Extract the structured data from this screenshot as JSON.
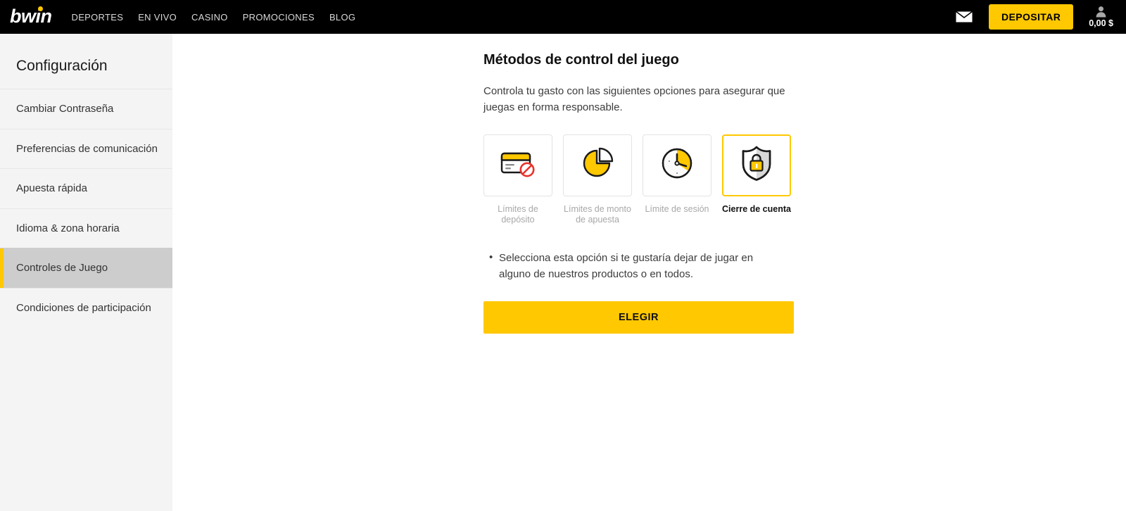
{
  "header": {
    "logo_text": "bwin",
    "logo_dot_color": "#ffc800",
    "nav": [
      {
        "label": "DEPORTES",
        "name": "nav-deportes"
      },
      {
        "label": "EN VIVO",
        "name": "nav-en-vivo"
      },
      {
        "label": "CASINO",
        "name": "nav-casino"
      },
      {
        "label": "PROMOCIONES",
        "name": "nav-promociones"
      },
      {
        "label": "BLOG",
        "name": "nav-blog"
      }
    ],
    "mail_icon": "envelope-icon",
    "deposit_label": "DEPOSITAR",
    "account_icon": "person-icon",
    "balance": "0,00 $",
    "accent_color": "#ffc800",
    "background": "#000000"
  },
  "sidebar": {
    "title": "Configuración",
    "background": "#f4f4f4",
    "active_background": "#cdcdcd",
    "active_marker_color": "#ffc800",
    "items": [
      {
        "label": "Cambiar Contraseña",
        "active": false
      },
      {
        "label": "Preferencias de comunicación",
        "active": false
      },
      {
        "label": "Apuesta rápida",
        "active": false
      },
      {
        "label": "Idioma & zona horaria",
        "active": false
      },
      {
        "label": "Controles de Juego",
        "active": true
      },
      {
        "label": "Condiciones de participación",
        "active": false
      }
    ]
  },
  "main": {
    "title": "Métodos de control del juego",
    "intro": "Controla tu gasto con las siguientes opciones para asegurar que juegas en forma responsable.",
    "options": [
      {
        "label": "Límites de depósito",
        "icon": "credit-card-blocked-icon",
        "selected": false
      },
      {
        "label": "Límites de monto de apuesta",
        "icon": "pie-chart-icon",
        "selected": false
      },
      {
        "label": "Límite de sesión",
        "icon": "clock-icon",
        "selected": false
      },
      {
        "label": "Cierre de cuenta",
        "icon": "shield-lock-icon",
        "selected": true
      }
    ],
    "bullets": [
      "Selecciona esta opción si te gustaría dejar de jugar en alguno de nuestros productos o en todos."
    ],
    "choose_label": "ELEGIR"
  }
}
